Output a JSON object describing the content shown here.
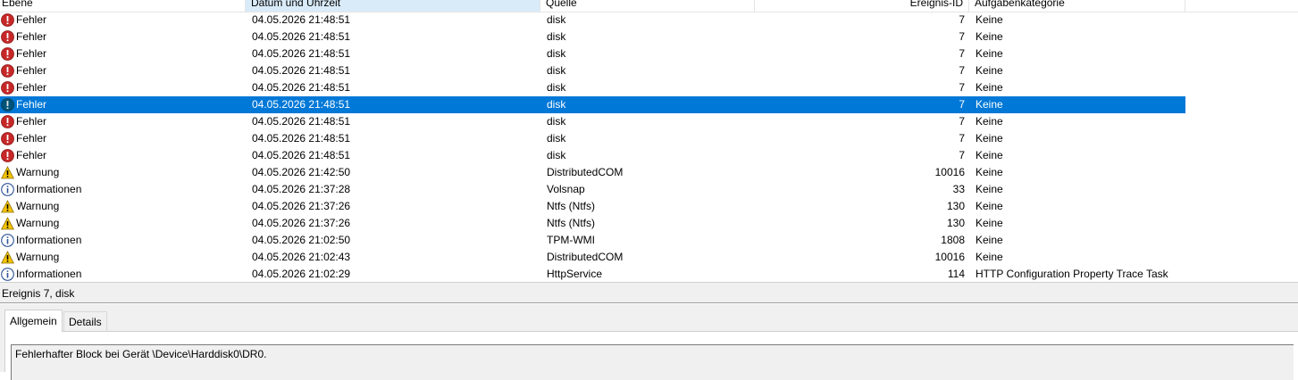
{
  "columns": {
    "level": "Ebene",
    "date": "Datum und Uhrzeit",
    "source": "Quelle",
    "event_id": "Ereignis-ID",
    "category": "Aufgabenkategorie"
  },
  "rows": [
    {
      "level": "Fehler",
      "icon": "error-icon",
      "date": "04.05.2026 21:48:51",
      "source": "disk",
      "event_id": "7",
      "category": "Keine"
    },
    {
      "level": "Fehler",
      "icon": "error-icon",
      "date": "04.05.2026 21:48:51",
      "source": "disk",
      "event_id": "7",
      "category": "Keine"
    },
    {
      "level": "Fehler",
      "icon": "error-icon",
      "date": "04.05.2026 21:48:51",
      "source": "disk",
      "event_id": "7",
      "category": "Keine"
    },
    {
      "level": "Fehler",
      "icon": "error-icon",
      "date": "04.05.2026 21:48:51",
      "source": "disk",
      "event_id": "7",
      "category": "Keine"
    },
    {
      "level": "Fehler",
      "icon": "error-icon",
      "date": "04.05.2026 21:48:51",
      "source": "disk",
      "event_id": "7",
      "category": "Keine"
    },
    {
      "level": "Fehler",
      "icon": "error-icon",
      "date": "04.05.2026 21:48:51",
      "source": "disk",
      "event_id": "7",
      "category": "Keine",
      "selected": true
    },
    {
      "level": "Fehler",
      "icon": "error-icon",
      "date": "04.05.2026 21:48:51",
      "source": "disk",
      "event_id": "7",
      "category": "Keine"
    },
    {
      "level": "Fehler",
      "icon": "error-icon",
      "date": "04.05.2026 21:48:51",
      "source": "disk",
      "event_id": "7",
      "category": "Keine"
    },
    {
      "level": "Fehler",
      "icon": "error-icon",
      "date": "04.05.2026 21:48:51",
      "source": "disk",
      "event_id": "7",
      "category": "Keine"
    },
    {
      "level": "Warnung",
      "icon": "warning-icon",
      "date": "04.05.2026 21:42:50",
      "source": "DistributedCOM",
      "event_id": "10016",
      "category": "Keine"
    },
    {
      "level": "Informationen",
      "icon": "info-icon",
      "date": "04.05.2026 21:37:28",
      "source": "Volsnap",
      "event_id": "33",
      "category": "Keine"
    },
    {
      "level": "Warnung",
      "icon": "warning-icon",
      "date": "04.05.2026 21:37:26",
      "source": "Ntfs (Ntfs)",
      "event_id": "130",
      "category": "Keine"
    },
    {
      "level": "Warnung",
      "icon": "warning-icon",
      "date": "04.05.2026 21:37:26",
      "source": "Ntfs (Ntfs)",
      "event_id": "130",
      "category": "Keine"
    },
    {
      "level": "Informationen",
      "icon": "info-icon",
      "date": "04.05.2026 21:02:50",
      "source": "TPM-WMI",
      "event_id": "1808",
      "category": "Keine"
    },
    {
      "level": "Warnung",
      "icon": "warning-icon",
      "date": "04.05.2026 21:02:43",
      "source": "DistributedCOM",
      "event_id": "10016",
      "category": "Keine"
    },
    {
      "level": "Informationen",
      "icon": "info-icon",
      "date": "04.05.2026 21:02:29",
      "source": "HttpService",
      "event_id": "114",
      "category": "HTTP Configuration Property Trace Task"
    }
  ],
  "detail": {
    "title": "Ereignis 7, disk",
    "tabs": [
      "Allgemein",
      "Details"
    ],
    "message": "Fehlerhafter Block bei Gerät \\Device\\Harddisk0\\DR0."
  },
  "colors": {
    "selection": "#0078d7",
    "sorted_header": "#d9ebf9",
    "error": "#d32f2f",
    "warning": "#f5c400",
    "info": "#ffffff"
  }
}
